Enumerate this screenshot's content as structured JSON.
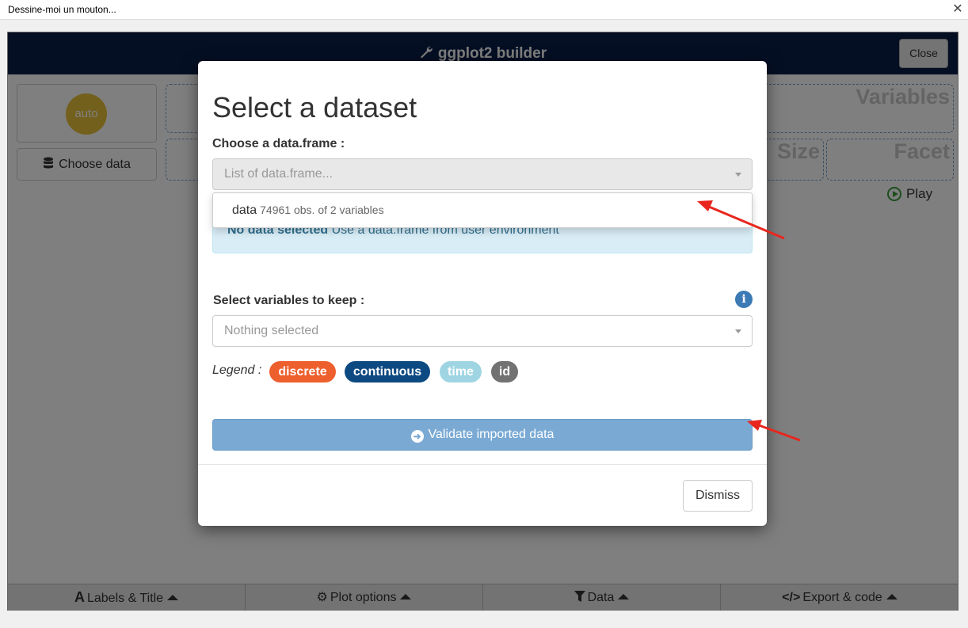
{
  "window": {
    "title": "Dessine-moi un mouton...",
    "close_glyph": "✕"
  },
  "app": {
    "header_title": "ggplot2 builder",
    "close_button": "Close",
    "auto_label": "auto",
    "choose_data_label": "Choose data",
    "drop_zones": {
      "variables": "Variables",
      "size": "Size",
      "facet": "Facet"
    },
    "play_label": "Play",
    "bottom_tabs": [
      "Labels & Title",
      "Plot options",
      "Data",
      "Export & code"
    ]
  },
  "modal": {
    "title": "Select a dataset",
    "dataframe_label": "Choose a data.frame :",
    "dataframe_placeholder": "List of data.frame...",
    "dropdown_option": {
      "name": "data",
      "detail": "74961 obs. of 2 variables"
    },
    "alert": {
      "strong": "No data selected",
      "text": "Use a data.frame from user environment"
    },
    "vars_label": "Select variables to keep :",
    "vars_placeholder": "Nothing selected",
    "legend_label": "Legend :",
    "legend_badges": [
      {
        "label": "discrete",
        "color": "#ee5f2e"
      },
      {
        "label": "continuous",
        "color": "#0e4a82"
      },
      {
        "label": "time",
        "color": "#9fd5e3"
      },
      {
        "label": "id",
        "color": "#727272"
      }
    ],
    "validate_label": "Validate imported data",
    "dismiss_label": "Dismiss"
  },
  "colors": {
    "header_bg": "#0a1f48",
    "annotation_arrow": "#e8261e",
    "primary_button": "#7aaad4",
    "alert_bg": "#d9edf7"
  }
}
